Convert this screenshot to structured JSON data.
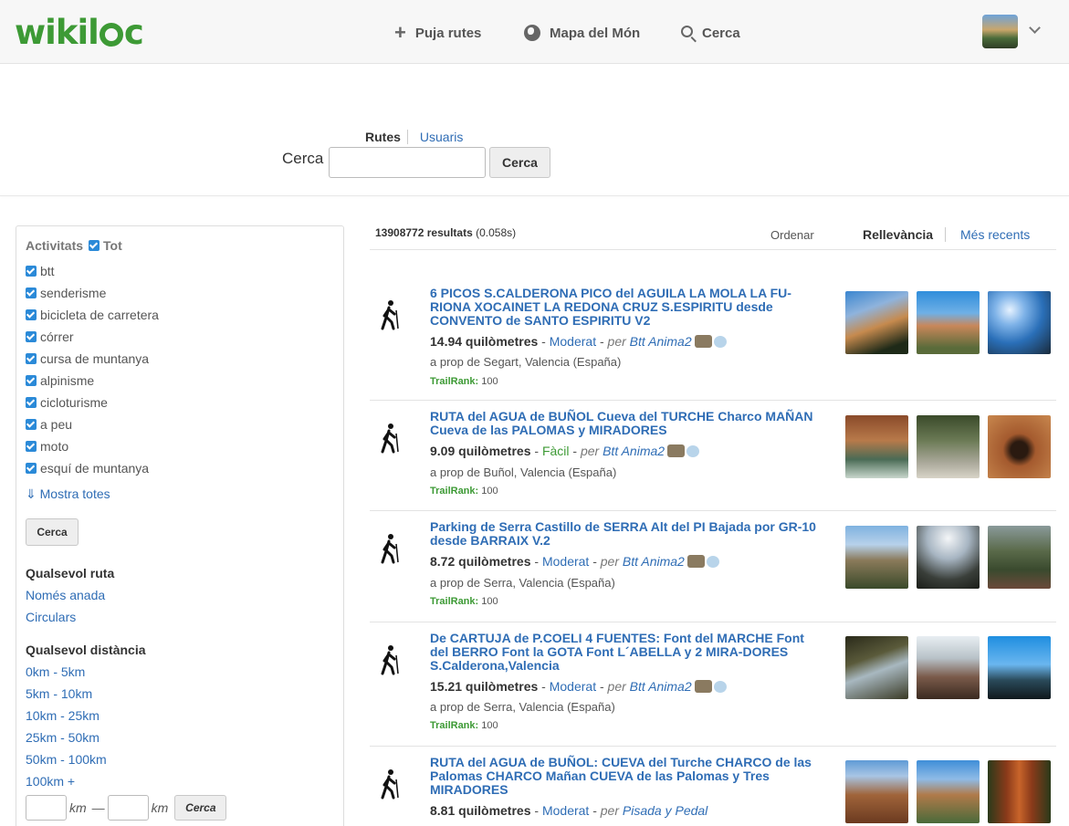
{
  "header": {
    "logo": "wikiloc",
    "nav": {
      "upload": "Puja rutes",
      "map": "Mapa del Món",
      "search": "Cerca"
    }
  },
  "search": {
    "tab_routes": "Rutes",
    "tab_users": "Usuaris",
    "label": "Cerca",
    "input_value": "",
    "button": "Cerca"
  },
  "sidebar": {
    "activities_title": "Activitats",
    "all_label": "Tot",
    "activities": [
      "btt",
      "senderisme",
      "bicicleta de carretera",
      "córrer",
      "cursa de muntanya",
      "alpinisme",
      "cicloturisme",
      "a peu",
      "moto",
      "esquí de muntanya"
    ],
    "show_all": "⇓ Mostra totes",
    "search_button": "Cerca",
    "route_type_title": "Qualsevol ruta",
    "route_types": [
      "Només anada",
      "Circulars"
    ],
    "distance_title": "Qualsevol distància",
    "distances": [
      "0km - 5km",
      "5km - 10km",
      "10km - 25km",
      "25km - 50km",
      "50km - 100km",
      "100km +"
    ],
    "km_unit": "km",
    "km_dash": "—",
    "km_button": "Cerca"
  },
  "results_header": {
    "count": "13908772 resultats",
    "time": "(0.058s)",
    "sort_label": "Ordenar",
    "sort_relevance": "Rellevància",
    "sort_recent": "Més recents"
  },
  "results": [
    {
      "title": "6 PICOS S.CALDERONA PICO del AGUILA LA MOLA LA FU-RIONA XOCAINET LA REDONA CRUZ S.ESPIRITU desde CONVENTO de SANTO ESPIRITU V2",
      "distance": "14.94 quilòmetres",
      "difficulty": "Moderat",
      "per": "per",
      "author": "Btt Anima2",
      "near": "a prop de Segart, Valencia (España)",
      "trailrank_label": "TrailRank:",
      "trailrank": "100"
    },
    {
      "title": "RUTA del AGUA de BUÑOL Cueva del TURCHE Charco MAÑAN Cueva de las PALOMAS y MIRADORES",
      "distance": "9.09 quilòmetres",
      "difficulty": "Fàcil",
      "per": "per",
      "author": "Btt Anima2",
      "near": "a prop de Buñol, Valencia (España)",
      "trailrank_label": "TrailRank:",
      "trailrank": "100"
    },
    {
      "title": "Parking de Serra Castillo de SERRA Alt del PI Bajada por GR-10 desde BARRAIX V.2",
      "distance": "8.72 quilòmetres",
      "difficulty": "Moderat",
      "per": "per",
      "author": "Btt Anima2",
      "near": "a prop de Serra, Valencia (España)",
      "trailrank_label": "TrailRank:",
      "trailrank": "100"
    },
    {
      "title": "De CARTUJA de P.COELI 4 FUENTES: Font del MARCHE Font del BERRO Font la GOTA Font L´ABELLA y 2 MIRA-DORES S.Calderona,Valencia",
      "distance": "15.21 quilòmetres",
      "difficulty": "Moderat",
      "per": "per",
      "author": "Btt Anima2",
      "near": "a prop de Serra, Valencia (España)",
      "trailrank_label": "TrailRank:",
      "trailrank": "100"
    },
    {
      "title": "RUTA del AGUA de BUÑOL: CUEVA del Turche CHARCO de las Palomas CHARCO Mañan CUEVA de las Palomas y Tres MIRADORES",
      "distance": "8.81 quilòmetres",
      "difficulty": "Moderat",
      "per": "per",
      "author": "Pisada y Pedal"
    }
  ],
  "colors": {
    "brand": "#3d9a35",
    "link": "#2f6db5",
    "checkbox": "#2b8ad8"
  },
  "icons": [
    "plus-icon",
    "globe-icon",
    "search-icon",
    "chevron-down-icon",
    "hiker-icon",
    "checkbox-icon"
  ]
}
